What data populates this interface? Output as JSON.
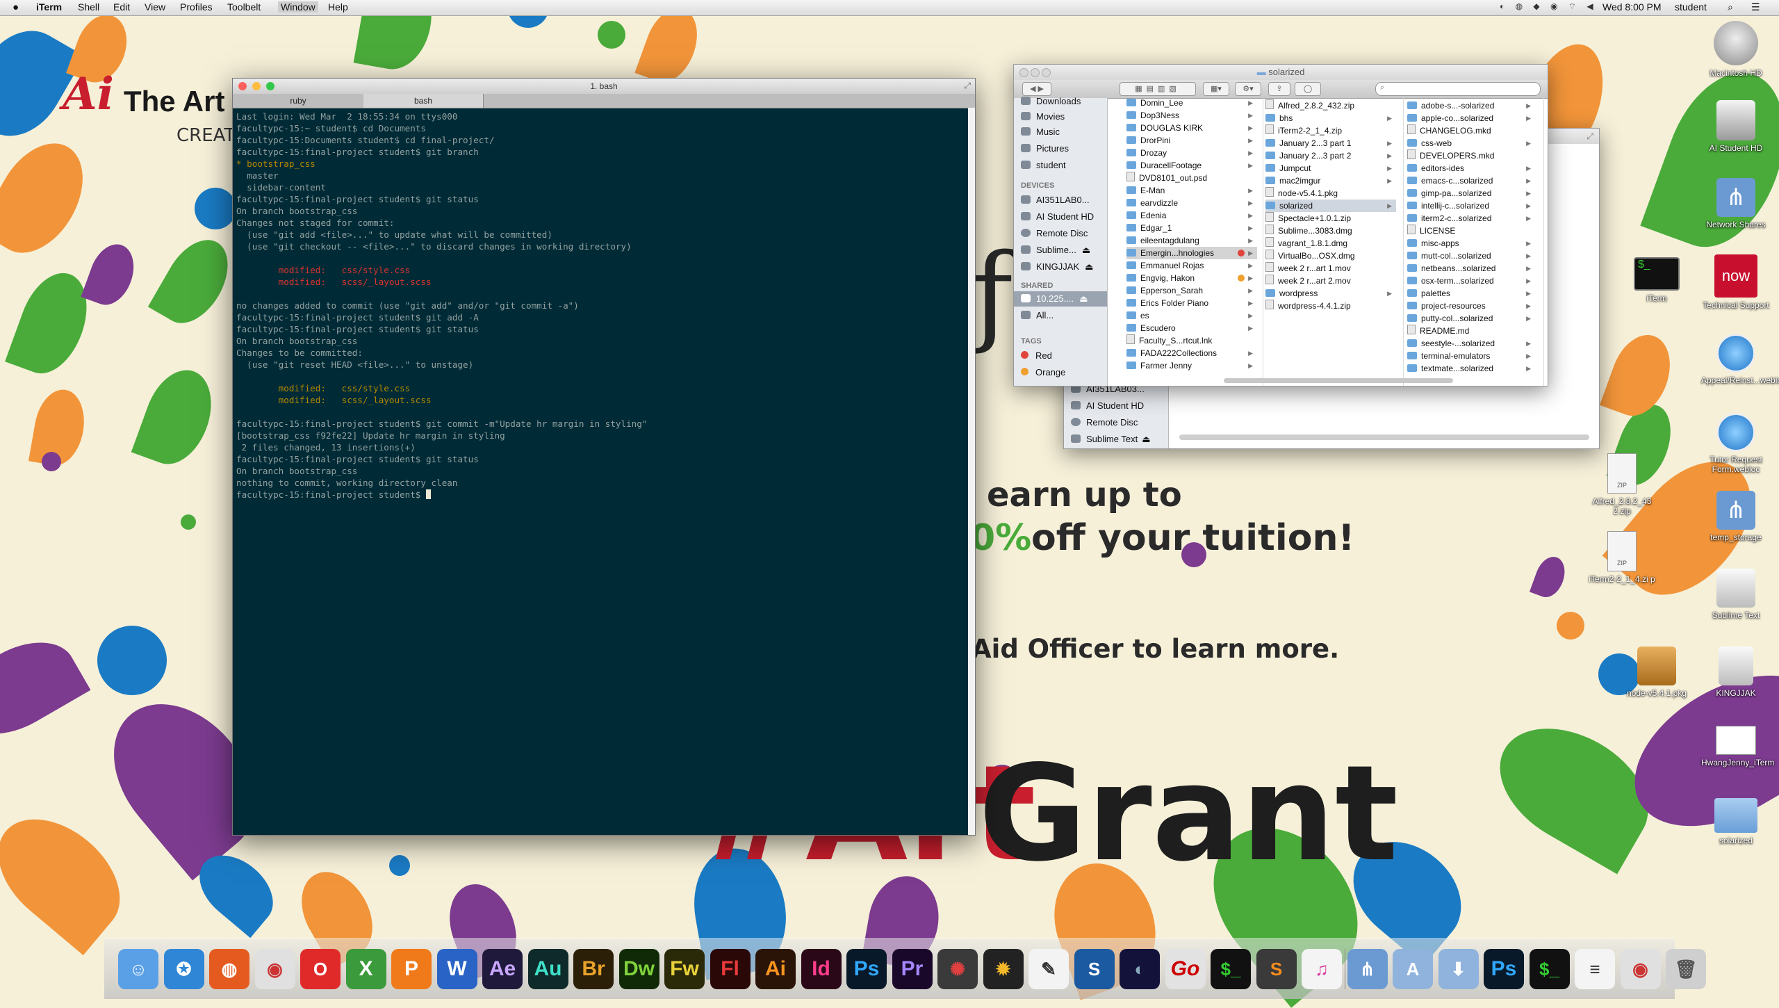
{
  "menubar": {
    "app_name": "iTerm",
    "menus": [
      "Shell",
      "Edit",
      "View",
      "Profiles",
      "Toolbelt",
      "Window",
      "Help"
    ],
    "datetime": "Wed 8:00 PM",
    "user": "student"
  },
  "wallpaper": {
    "logo_ai": "Ai",
    "logo_text": "The Art I",
    "logo_sub": "CREAT",
    "line1": "earn up to",
    "line2_pct": "0%",
    "line2": "off your tuition!",
    "line3": "Aid Officer to learn more.",
    "grant_text": "Grant",
    "hash_text": "#Art"
  },
  "terminal": {
    "title": "1. bash",
    "tabs": [
      "ruby",
      "bash"
    ],
    "lines": [
      {
        "t": "Last login: Wed Mar  2 18:55:34 on ttys000",
        "c": ""
      },
      {
        "t": "facultypc-15:~ student$ cd Documents",
        "c": ""
      },
      {
        "t": "facultypc-15:Documents student$ cd final-project/",
        "c": ""
      },
      {
        "t": "facultypc-15:final-project student$ git branch",
        "c": ""
      },
      {
        "t": "* bootstrap_css",
        "c": "yellow"
      },
      {
        "t": "  master",
        "c": ""
      },
      {
        "t": "  sidebar-content",
        "c": ""
      },
      {
        "t": "facultypc-15:final-project student$ git status",
        "c": ""
      },
      {
        "t": "On branch bootstrap_css",
        "c": ""
      },
      {
        "t": "Changes not staged for commit:",
        "c": ""
      },
      {
        "t": "  (use \"git add <file>...\" to update what will be committed)",
        "c": ""
      },
      {
        "t": "  (use \"git checkout -- <file>...\" to discard changes in working directory)",
        "c": ""
      },
      {
        "t": "",
        "c": ""
      },
      {
        "t": "        modified:   css/style.css",
        "c": "red"
      },
      {
        "t": "        modified:   scss/_layout.scss",
        "c": "red"
      },
      {
        "t": "",
        "c": ""
      },
      {
        "t": "no changes added to commit (use \"git add\" and/or \"git commit -a\")",
        "c": ""
      },
      {
        "t": "facultypc-15:final-project student$ git add -A",
        "c": ""
      },
      {
        "t": "facultypc-15:final-project student$ git status",
        "c": ""
      },
      {
        "t": "On branch bootstrap_css",
        "c": ""
      },
      {
        "t": "Changes to be committed:",
        "c": ""
      },
      {
        "t": "  (use \"git reset HEAD <file>...\" to unstage)",
        "c": ""
      },
      {
        "t": "",
        "c": ""
      },
      {
        "t": "        modified:   css/style.css",
        "c": "yellow"
      },
      {
        "t": "        modified:   scss/_layout.scss",
        "c": "yellow"
      },
      {
        "t": "",
        "c": ""
      },
      {
        "t": "facultypc-15:final-project student$ git commit -m\"Update hr margin in styling\"",
        "c": ""
      },
      {
        "t": "[bootstrap_css f92fe22] Update hr margin in styling",
        "c": ""
      },
      {
        "t": " 2 files changed, 13 insertions(+)",
        "c": ""
      },
      {
        "t": "facultypc-15:final-project student$ git status",
        "c": ""
      },
      {
        "t": "On branch bootstrap_css",
        "c": ""
      },
      {
        "t": "nothing to commit, working directory clean",
        "c": ""
      },
      {
        "t": "facultypc-15:final-project student$ ",
        "c": "prompt"
      }
    ]
  },
  "finder_front": {
    "title": "solarized",
    "search_placeholder": "",
    "sidebar_top": [
      "Downloads",
      "Movies",
      "Music",
      "Pictures",
      "student"
    ],
    "devices_header": "DEVICES",
    "devices": [
      "AI351LAB0...",
      "AI Student HD",
      "Remote Disc",
      "Sublime...",
      "KINGJJAK"
    ],
    "shared_header": "SHARED",
    "shared": [
      "10.225....",
      "All..."
    ],
    "tags_header": "TAGS",
    "tags": [
      {
        "name": "Red",
        "color": "#e0453c"
      },
      {
        "name": "Orange",
        "color": "#f0a030"
      }
    ],
    "col1": [
      "Domin_Lee",
      "Dop3Ness",
      "DOUGLAS KIRK",
      "DrorPini",
      "Drozay",
      "DuracellFootage",
      "DVD8101_out.psd",
      "E-Man",
      "earvdizzle",
      "Edenia",
      "Edgar_1",
      "eileentagdulang",
      "Emergin...hnologies",
      "Emmanuel Rojas",
      "Engvig, Hakon",
      "Epperson_Sarah",
      "Erics Folder Piano",
      "es",
      "Escudero",
      "Faculty_S...rtcut.lnk",
      "FADA222Collections",
      "Farmer Jenny"
    ],
    "col2": [
      "Alfred_2.8.2_432.zip",
      "bhs",
      "iTerm2-2_1_4.zip",
      "January 2...3 part 1",
      "January 2...3 part 2",
      "Jumpcut",
      "mac2imgur",
      "node-v5.4.1.pkg",
      "solarized",
      "Spectacle+1.0.1.zip",
      "Sublime...3083.dmg",
      "vagrant_1.8.1.dmg",
      "VirtualBo...OSX.dmg",
      "week 2 r...art 1.mov",
      "week 2 r...art 2.mov",
      "wordpress",
      "wordpress-4.4.1.zip"
    ],
    "col3": [
      "adobe-s...-solarized",
      "apple-co...solarized",
      "CHANGELOG.mkd",
      "css-web",
      "DEVELOPERS.mkd",
      "editors-ides",
      "emacs-c...solarized",
      "gimp-pa...solarized",
      "intellij-c...solarized",
      "iterm2-c...solarized",
      "LICENSE",
      "misc-apps",
      "mutt-col...solarized",
      "netbeans...solarized",
      "osx-term...solarized",
      "palettes",
      "project-resources",
      "putty-col...solarized",
      "README.md",
      "seestyle-...solarized",
      "terminal-emulators",
      "textmate...solarized"
    ]
  },
  "finder_back": {
    "items": [
      "AI351LAB03...",
      "AI Student HD",
      "Remote Disc",
      "Sublime Text"
    ]
  },
  "desktop_icons": [
    "Macintosh HD",
    "AI Student HD",
    "Network Shares",
    "iTerm",
    "Technical Support",
    "Appeal/Reinst...webloc",
    "Tutor Request Form.webloc",
    "Alfred_2.8.2_43 2.zip",
    "temp_storage",
    "iTerm2-2_1_4.zi p",
    "Sublime Text",
    "node-v5.4.1.pkg",
    "KINGJJAK",
    "HwangJenny_iTerm",
    "solarized"
  ],
  "dock": [
    "Finder",
    "Safari",
    "Firefox",
    "Chrome",
    "Opera",
    "X",
    "P",
    "W",
    "Ae",
    "Au",
    "Br",
    "Dw",
    "Fw",
    "Fl",
    "Ai",
    "Id",
    "Ps",
    "Pr",
    "DaVinci",
    "Sun",
    "Sk",
    "Sketch",
    "Cinema",
    "Go",
    "Terminal",
    "Sublime",
    "iTunes",
    "Network",
    "Apps",
    "Downloads",
    "Ps",
    "Terminal",
    "Doc",
    "Chrome",
    "Trash"
  ],
  "colors": {
    "term_bg": "#002b36",
    "term_fg": "#93a1a1",
    "term_red": "#dc322f",
    "term_yellow": "#b58900",
    "wall_bg": "#f6f0d9",
    "green": "#4aab3a",
    "orange": "#f2953a",
    "purple": "#7c3b8f",
    "blue": "#1a7bc4"
  }
}
